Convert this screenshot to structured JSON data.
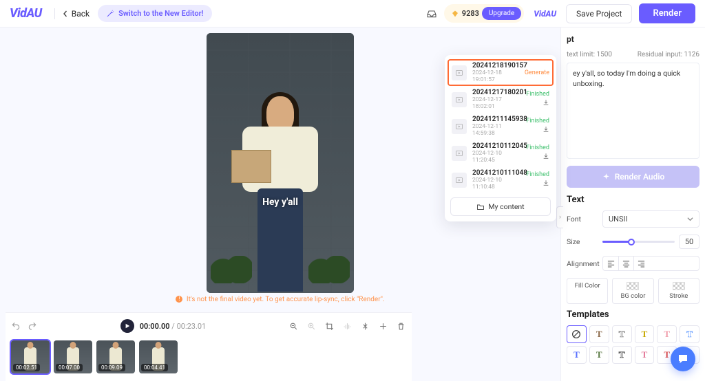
{
  "app": {
    "name": "VidAU"
  },
  "header": {
    "back_label": "Back",
    "switch_label": "Switch to the New Editor!",
    "credits": "9283",
    "upgrade_label": "Upgrade",
    "save_label": "Save Project",
    "render_label": "Render"
  },
  "preview": {
    "caption": "Hey y'all",
    "note_text": "It's not the final video yet. To get accurate lip-sync, click \"Render\"."
  },
  "projects_popup": {
    "items": [
      {
        "name": "20241218190157",
        "date": "2024-12-18 19:01:57",
        "status": "Generate",
        "status_kind": "gen",
        "highlight": true,
        "downloadable": false
      },
      {
        "name": "20241217180201",
        "date": "2024-12-17 18:02:01",
        "status": "Finished",
        "status_kind": "ok",
        "highlight": false,
        "downloadable": true
      },
      {
        "name": "20241211145938",
        "date": "2024-12-11 14:59:38",
        "status": "Finished",
        "status_kind": "ok",
        "highlight": false,
        "downloadable": true
      },
      {
        "name": "20241210112045",
        "date": "2024-12-10 11:20:45",
        "status": "Finished",
        "status_kind": "ok",
        "highlight": false,
        "downloadable": true
      },
      {
        "name": "20241210111048",
        "date": "2024-12-10 11:10:48",
        "status": "Finished",
        "status_kind": "ok",
        "highlight": false,
        "downloadable": true
      }
    ],
    "my_content_label": "My content"
  },
  "right": {
    "script_heading": "pt",
    "limit_label": "text limit: 1500",
    "residual_label": "Residual input: 1126",
    "script_text": "ey y'all, so today I'm doing a quick unboxing.",
    "render_audio_label": "Render Audio",
    "text_heading": "Text",
    "font_label": "Font",
    "font_value": "UNSII",
    "size_label": "Size",
    "size_value": "50",
    "align_label": "Alignment",
    "fill_label": "Fill Color",
    "bg_label": "BG color",
    "stroke_label": "Stroke",
    "templates_label": "Templates"
  },
  "timeline": {
    "current": "00:00.00",
    "total": "00:23.01",
    "clips": [
      {
        "dur": "00:02.51",
        "selected": true
      },
      {
        "dur": "00:07.00",
        "selected": false
      },
      {
        "dur": "00:09.09",
        "selected": false
      },
      {
        "dur": "00:04.41",
        "selected": false
      }
    ]
  },
  "templates": {
    "row1": [
      {
        "kind": "none"
      },
      {
        "kind": "T",
        "color": "#8a6848"
      },
      {
        "kind": "T",
        "color": "#7a7a7a",
        "outline": true
      },
      {
        "kind": "T",
        "color": "#c7a800"
      },
      {
        "kind": "T",
        "color": "#f09aa8"
      },
      {
        "kind": "T",
        "color": "#6aa0ff",
        "outline": true
      }
    ],
    "row2": [
      {
        "kind": "T",
        "color": "#5a71ff"
      },
      {
        "kind": "T",
        "color": "#5a7a43"
      },
      {
        "kind": "T",
        "color": "#333333",
        "outline": true
      },
      {
        "kind": "T",
        "color": "#e37a9a"
      },
      {
        "kind": "T",
        "color": "#d94b4b"
      },
      {
        "kind": "T",
        "color": "#3f64d6",
        "outline": true
      }
    ]
  }
}
